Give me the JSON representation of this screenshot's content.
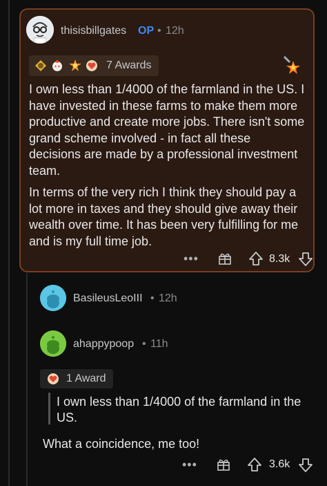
{
  "top_comment": {
    "username": "thisisbillgates",
    "op_badge": "OP",
    "separator": "•",
    "time": "12h",
    "awards_label": "7 Awards",
    "paragraph_1": "I own less than 1/4000 of the farmland in the US. I have invested in these farms to make them more productive and create more jobs. There isn't some grand scheme involved - in fact all these decisions are made by a professional investment team.",
    "paragraph_2": "In terms of the very rich I think they should pay a lot more in taxes and they should give away their wealth over time. It has been very fulfilling for me and is my full time job.",
    "more": "•••",
    "score": "8.3k"
  },
  "reply_1": {
    "username": "BasileusLeoIII",
    "separator": "•",
    "time": "12h"
  },
  "reply_2": {
    "username": "ahappypoop",
    "separator": "•",
    "time": "11h",
    "awards_label": "1 Award",
    "quote": "I own less than 1/4000 of the farmland in the US.",
    "text": "What a coincidence, me too!",
    "more": "•••",
    "score": "3.6k"
  },
  "colors": {
    "op_blue": "#3d8bf0",
    "highlight_border": "#7a3e22",
    "highlight_bg": "#2a1a12"
  },
  "icons": [
    "award-icon",
    "gift-icon",
    "upvote-icon",
    "downvote-icon",
    "burst-icon"
  ]
}
